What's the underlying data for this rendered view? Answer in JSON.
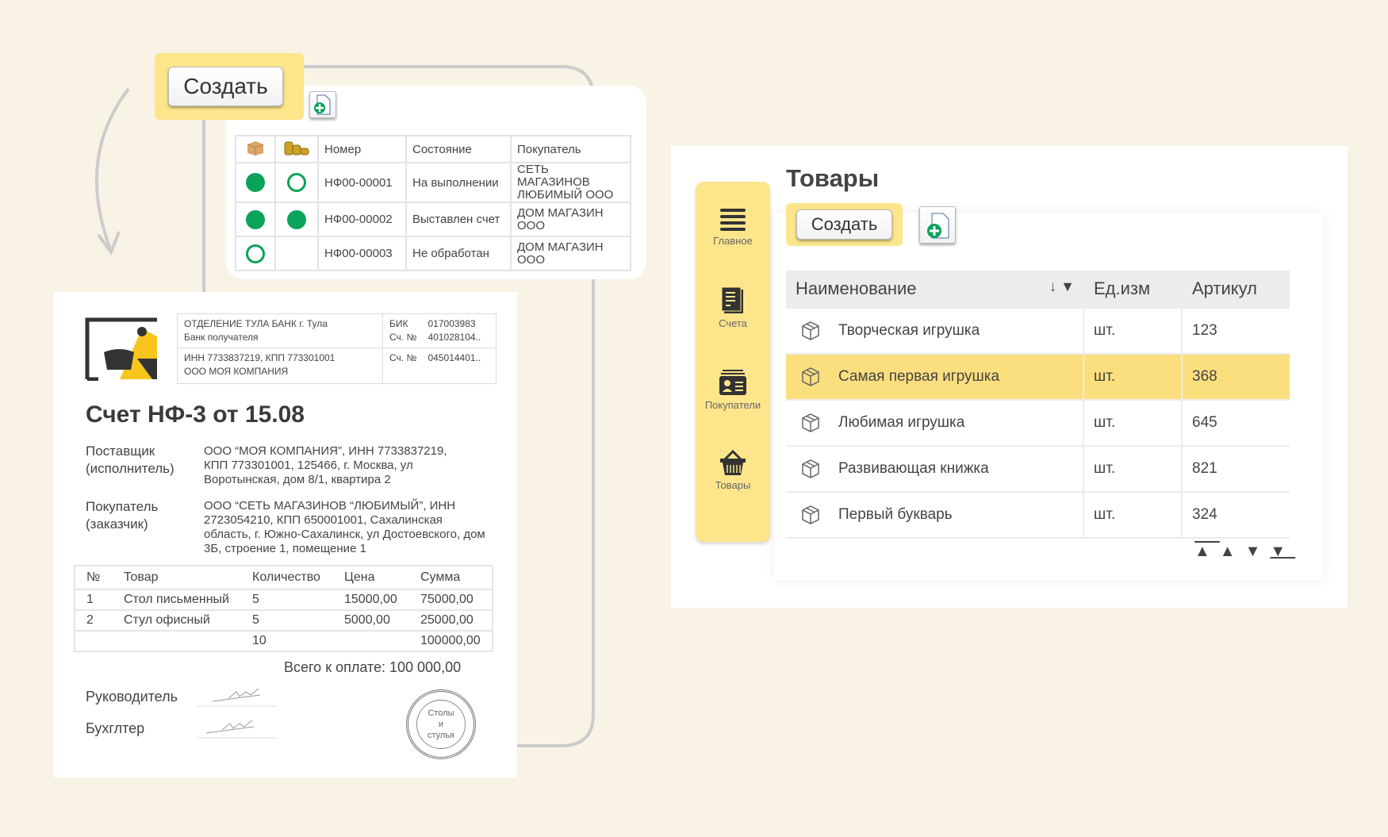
{
  "left_card": {
    "create_button": "Создать",
    "add_doc_icon": "document-add-icon",
    "columns": [
      "box-icon",
      "coins-icon",
      "Номер",
      "Состояние",
      "Покупатель"
    ],
    "rows": [
      {
        "shipped": "filled",
        "paid": "empty",
        "number": "НФ00-00001",
        "state": "На выполнении",
        "buyer": "СЕТЬ МАГАЗИНОВ ЛЮБИМЫЙ ООО"
      },
      {
        "shipped": "filled",
        "paid": "filled",
        "number": "НФ00-00002",
        "state": "Выставлен счет",
        "buyer": "ДОМ МАГАЗИН ООО"
      },
      {
        "shipped": "empty",
        "paid": "none",
        "number": "НФ00-00003",
        "state": "Не обработан",
        "buyer": "ДОМ МАГАЗИН ООО"
      }
    ]
  },
  "invoice": {
    "bank_name": "ОТДЕЛЕНИЕ ТУЛА БАНК г. Тула",
    "bank_label": "Банк получателя",
    "inn_kpp": "ИНН 7733837219, КПП 773301001",
    "company": "ООО МОЯ КОМПАНИЯ",
    "bik_label": "БИК",
    "bik": "017003983",
    "acc_label": "Сч. №",
    "acc1": "401028104..",
    "acc2": "045014401..",
    "title": "Счет НФ-3 от 15.08",
    "supplier_label": "Поставщик (исполнитель)",
    "supplier": "ООО “МОЯ КОМПАНИЯ”, ИНН 7733837219, КПП 773301001, 125466, г. Москва, ул Воротынская, дом 8/1, квартира 2",
    "buyer_label": "Покупатель (заказчик)",
    "buyer": "ООО “СЕТЬ МАГАЗИНОВ “ЛЮБИМЫЙ”, ИНН 2723054210, КПП 650001001, Сахалинская область, г. Южно-Сахалинск, ул Достоевского, дом 3Б, строение 1, помещение 1",
    "columns": [
      "№",
      "Товар",
      "Количество",
      "Цена",
      "Сумма"
    ],
    "items": [
      {
        "n": "1",
        "name": "Стол письменный",
        "qty": "5",
        "price": "15000,00",
        "sum": "75000,00"
      },
      {
        "n": "2",
        "name": "Стул офисный",
        "qty": "5",
        "price": "5000,00",
        "sum": "25000,00"
      }
    ],
    "total_qty": "10",
    "total_sum": "100000,00",
    "total_label": "Всего к оплате: 100 000,00",
    "director": "Руководитель",
    "accountant": "Бухглтер",
    "stamp": {
      "line1": "Столы",
      "line2": "и",
      "line3": "стулья"
    }
  },
  "goods": {
    "title": "Товары",
    "create_button": "Создать",
    "sidebar": [
      {
        "label": "Главное",
        "icon": "menu-icon"
      },
      {
        "label": "Счета",
        "icon": "invoice-icon"
      },
      {
        "label": "Покупатели",
        "icon": "contacts-icon"
      },
      {
        "label": "Товары",
        "icon": "basket-icon"
      }
    ],
    "columns": [
      "Наименование",
      "Ед.изм",
      "Артикул"
    ],
    "rows": [
      {
        "name": "Творческая игрушка",
        "unit": "шт.",
        "sku": "123"
      },
      {
        "name": "Самая первая игрушка",
        "unit": "шт.",
        "sku": "368",
        "selected": true
      },
      {
        "name": "Любимая игрушка",
        "unit": "шт.",
        "sku": "645"
      },
      {
        "name": "Развивающая книжка",
        "unit": "шт.",
        "sku": "821"
      },
      {
        "name": "Первый букварь",
        "unit": "шт.",
        "sku": "324"
      }
    ],
    "accent": "#fde58c",
    "selected_color": "#fbdf7e"
  }
}
